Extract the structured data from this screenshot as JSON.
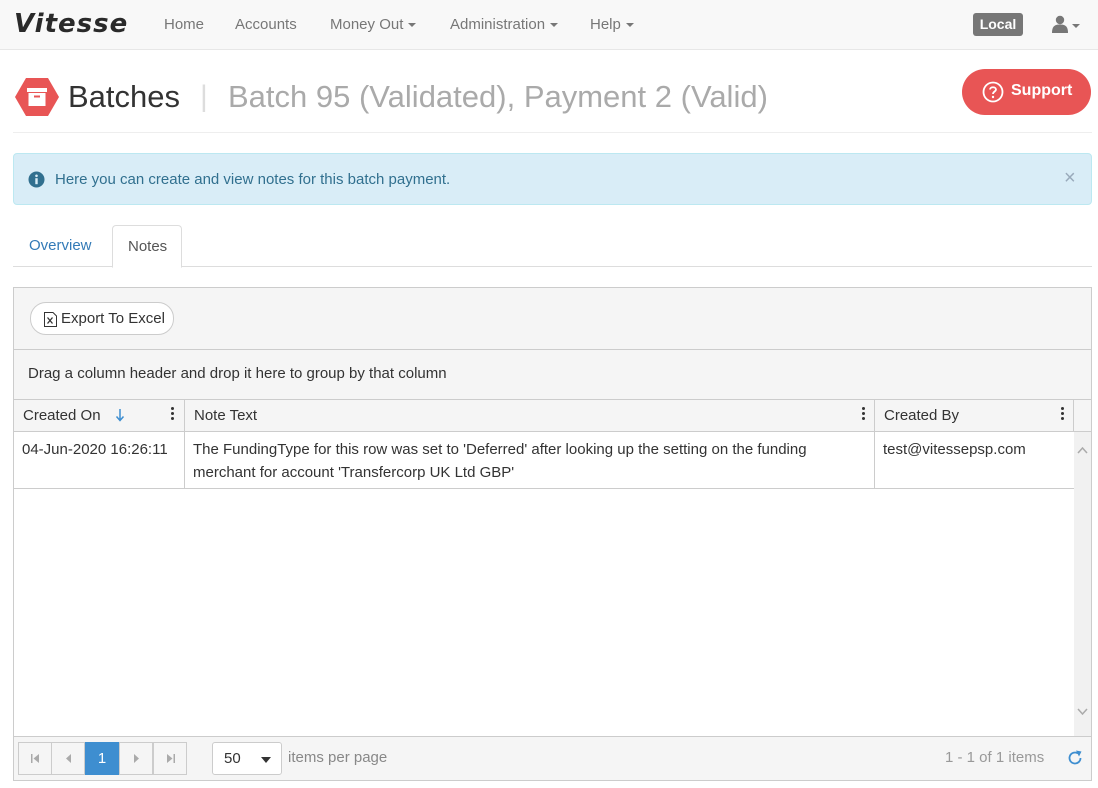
{
  "nav": {
    "logo": "Vitesse",
    "items": [
      {
        "label": "Home",
        "dropdown": false
      },
      {
        "label": "Accounts",
        "dropdown": false
      },
      {
        "label": "Money Out",
        "dropdown": true
      },
      {
        "label": "Administration",
        "dropdown": true
      },
      {
        "label": "Help",
        "dropdown": true
      }
    ],
    "env_badge": "Local",
    "user_icon": "user-icon"
  },
  "header": {
    "title": "Batches",
    "separator": "|",
    "subtitle": "Batch 95 (Validated), Payment 2 (Valid)",
    "icon": "archive-box-icon",
    "support_label": "Support"
  },
  "alert": {
    "text": "Here you can create and view notes for this batch payment.",
    "close": "×"
  },
  "tabs": [
    {
      "label": "Overview",
      "active": false
    },
    {
      "label": "Notes",
      "active": true
    }
  ],
  "grid": {
    "export_label": "Export To Excel",
    "grouping_hint": "Drag a column header and drop it here to group by that column",
    "columns": [
      {
        "label": "Created On",
        "sorted": "descending"
      },
      {
        "label": "Note Text"
      },
      {
        "label": "Created By"
      }
    ],
    "rows": [
      {
        "created_on": "04-Jun-2020 16:26:11",
        "note_text": "The FundingType for this row was set to 'Deferred' after looking up the setting on the funding merchant for account 'Transfercorp UK Ltd GBP'",
        "created_by": "test@vitessepsp.com"
      }
    ],
    "pager": {
      "current_page": "1",
      "page_size": "50",
      "items_per_page_label": "items per page",
      "info": "1 - 1 of 1 items"
    }
  },
  "colors": {
    "accent": "#3e8ed0",
    "support": "#e85555",
    "alert_bg": "#d9edf7",
    "alert_text": "#31708f",
    "link": "#337ab7"
  }
}
